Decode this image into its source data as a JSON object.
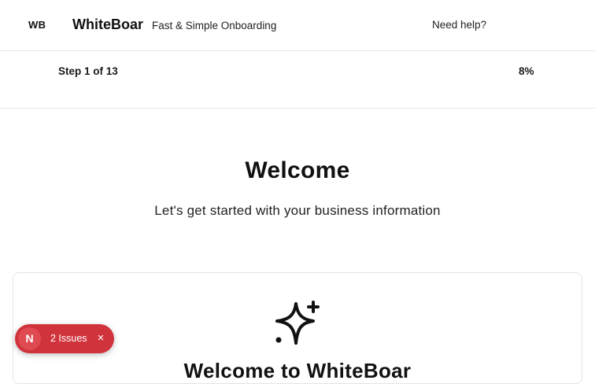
{
  "header": {
    "logo_text": "WB",
    "brand_name": "WhiteBoar",
    "tagline": "Fast & Simple Onboarding",
    "help_label": "Need help?"
  },
  "progress": {
    "step_label": "Step 1 of 13",
    "percent_label": "8%"
  },
  "hero": {
    "title": "Welcome",
    "subtitle": "Let's get started with your business information"
  },
  "card": {
    "icon": "sparkles-icon",
    "title": "Welcome to WhiteBoar"
  },
  "dev_overlay": {
    "avatar_letter": "N",
    "issues_label": "2 Issues",
    "close_glyph": "×",
    "color": "#d0333b"
  }
}
